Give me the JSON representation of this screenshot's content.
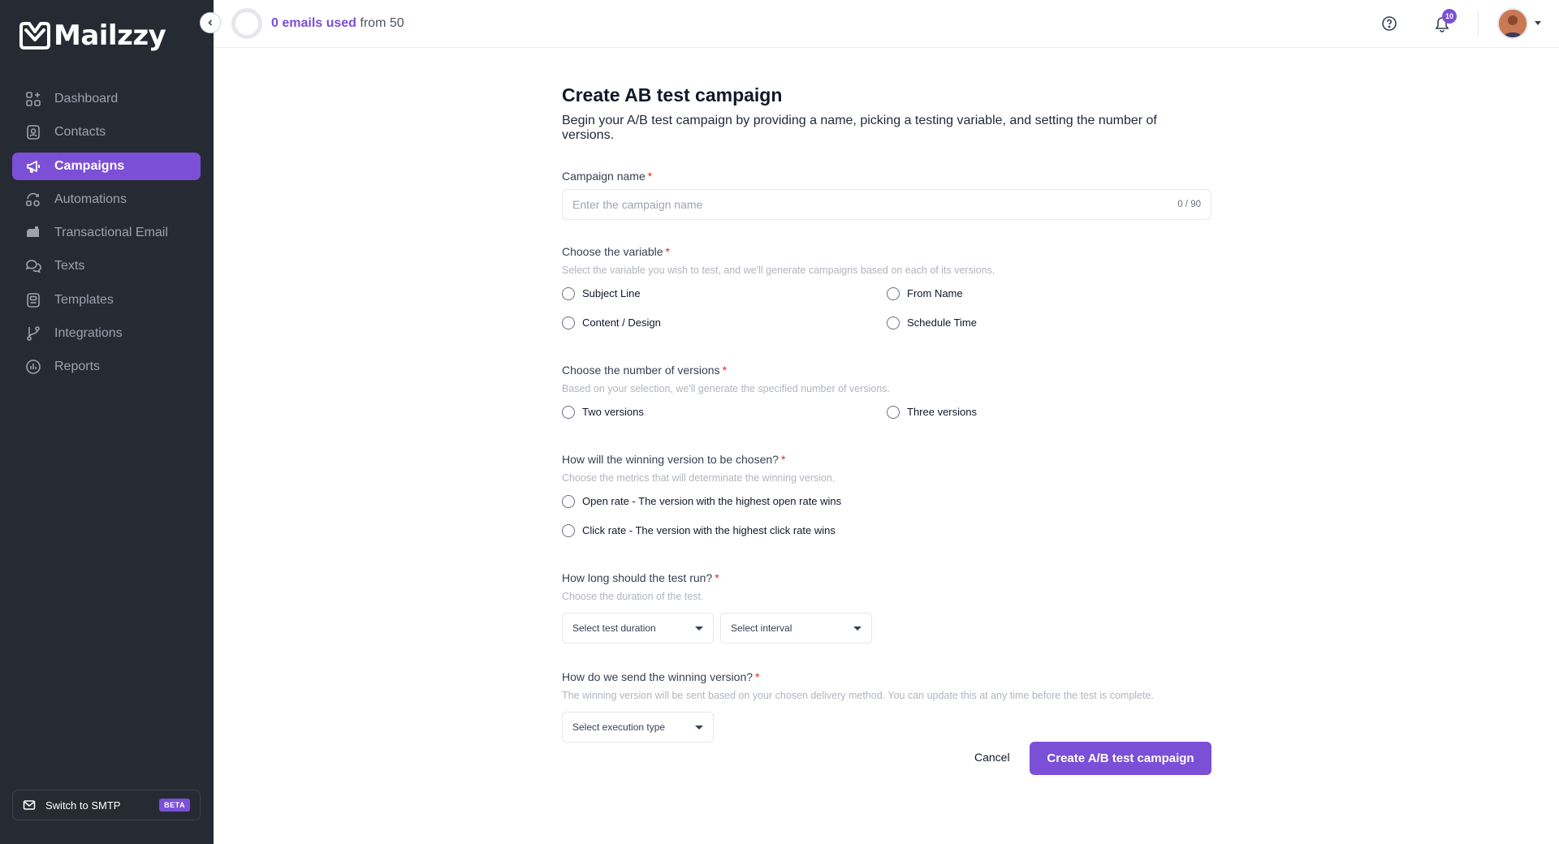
{
  "app": {
    "name": "Mailzzy"
  },
  "colors": {
    "accent": "#7b4fd6",
    "sidebar_bg": "#262a33",
    "required": "#dc2626"
  },
  "sidebar": {
    "items": [
      {
        "label": "Dashboard",
        "icon": "dashboard-icon"
      },
      {
        "label": "Contacts",
        "icon": "contacts-icon"
      },
      {
        "label": "Campaigns",
        "icon": "megaphone-icon",
        "active": true
      },
      {
        "label": "Automations",
        "icon": "automations-icon"
      },
      {
        "label": "Transactional Email",
        "icon": "mailbox-icon"
      },
      {
        "label": "Texts",
        "icon": "chat-icon"
      },
      {
        "label": "Templates",
        "icon": "templates-icon"
      },
      {
        "label": "Integrations",
        "icon": "branch-icon"
      },
      {
        "label": "Reports",
        "icon": "reports-icon"
      }
    ],
    "smtp": {
      "label": "Switch to SMTP",
      "badge": "BETA"
    }
  },
  "header": {
    "usage_count": "0 emails used",
    "usage_from": "from 50",
    "notifications_count": "10"
  },
  "form": {
    "title": "Create AB test campaign",
    "subtitle": "Begin your A/B test campaign by providing a name, picking a testing variable, and setting the number of versions.",
    "name": {
      "label": "Campaign name",
      "placeholder": "Enter the campaign name",
      "counter": "0 / 90",
      "value": ""
    },
    "variable": {
      "label": "Choose the variable",
      "helper": "Select the variable you wish to test, and we'll generate campaigns based on each of its versions.",
      "options": [
        "Subject Line",
        "From Name",
        "Content / Design",
        "Schedule Time"
      ]
    },
    "versions": {
      "label": "Choose the number of versions",
      "helper": "Based on your selection, we'll generate the specified number of versions.",
      "options": [
        "Two versions",
        "Three versions"
      ]
    },
    "winner": {
      "label": "How will the winning version to be chosen?",
      "helper": "Choose the metrics that will determinate the winning version.",
      "options": [
        "Open rate - The version with the highest open rate wins",
        "Click rate - The version with the highest click rate wins"
      ]
    },
    "duration": {
      "label": "How long should the test run?",
      "helper": "Choose the duration of the test.",
      "duration_placeholder": "Select test duration",
      "interval_placeholder": "Select interval"
    },
    "send": {
      "label": "How do we send the winning version?",
      "helper": "The winning version will be sent based on your chosen delivery method. You can update this at any time before the test is complete.",
      "execution_placeholder": "Select execution type"
    },
    "cancel_label": "Cancel",
    "submit_label": "Create A/B test campaign"
  }
}
